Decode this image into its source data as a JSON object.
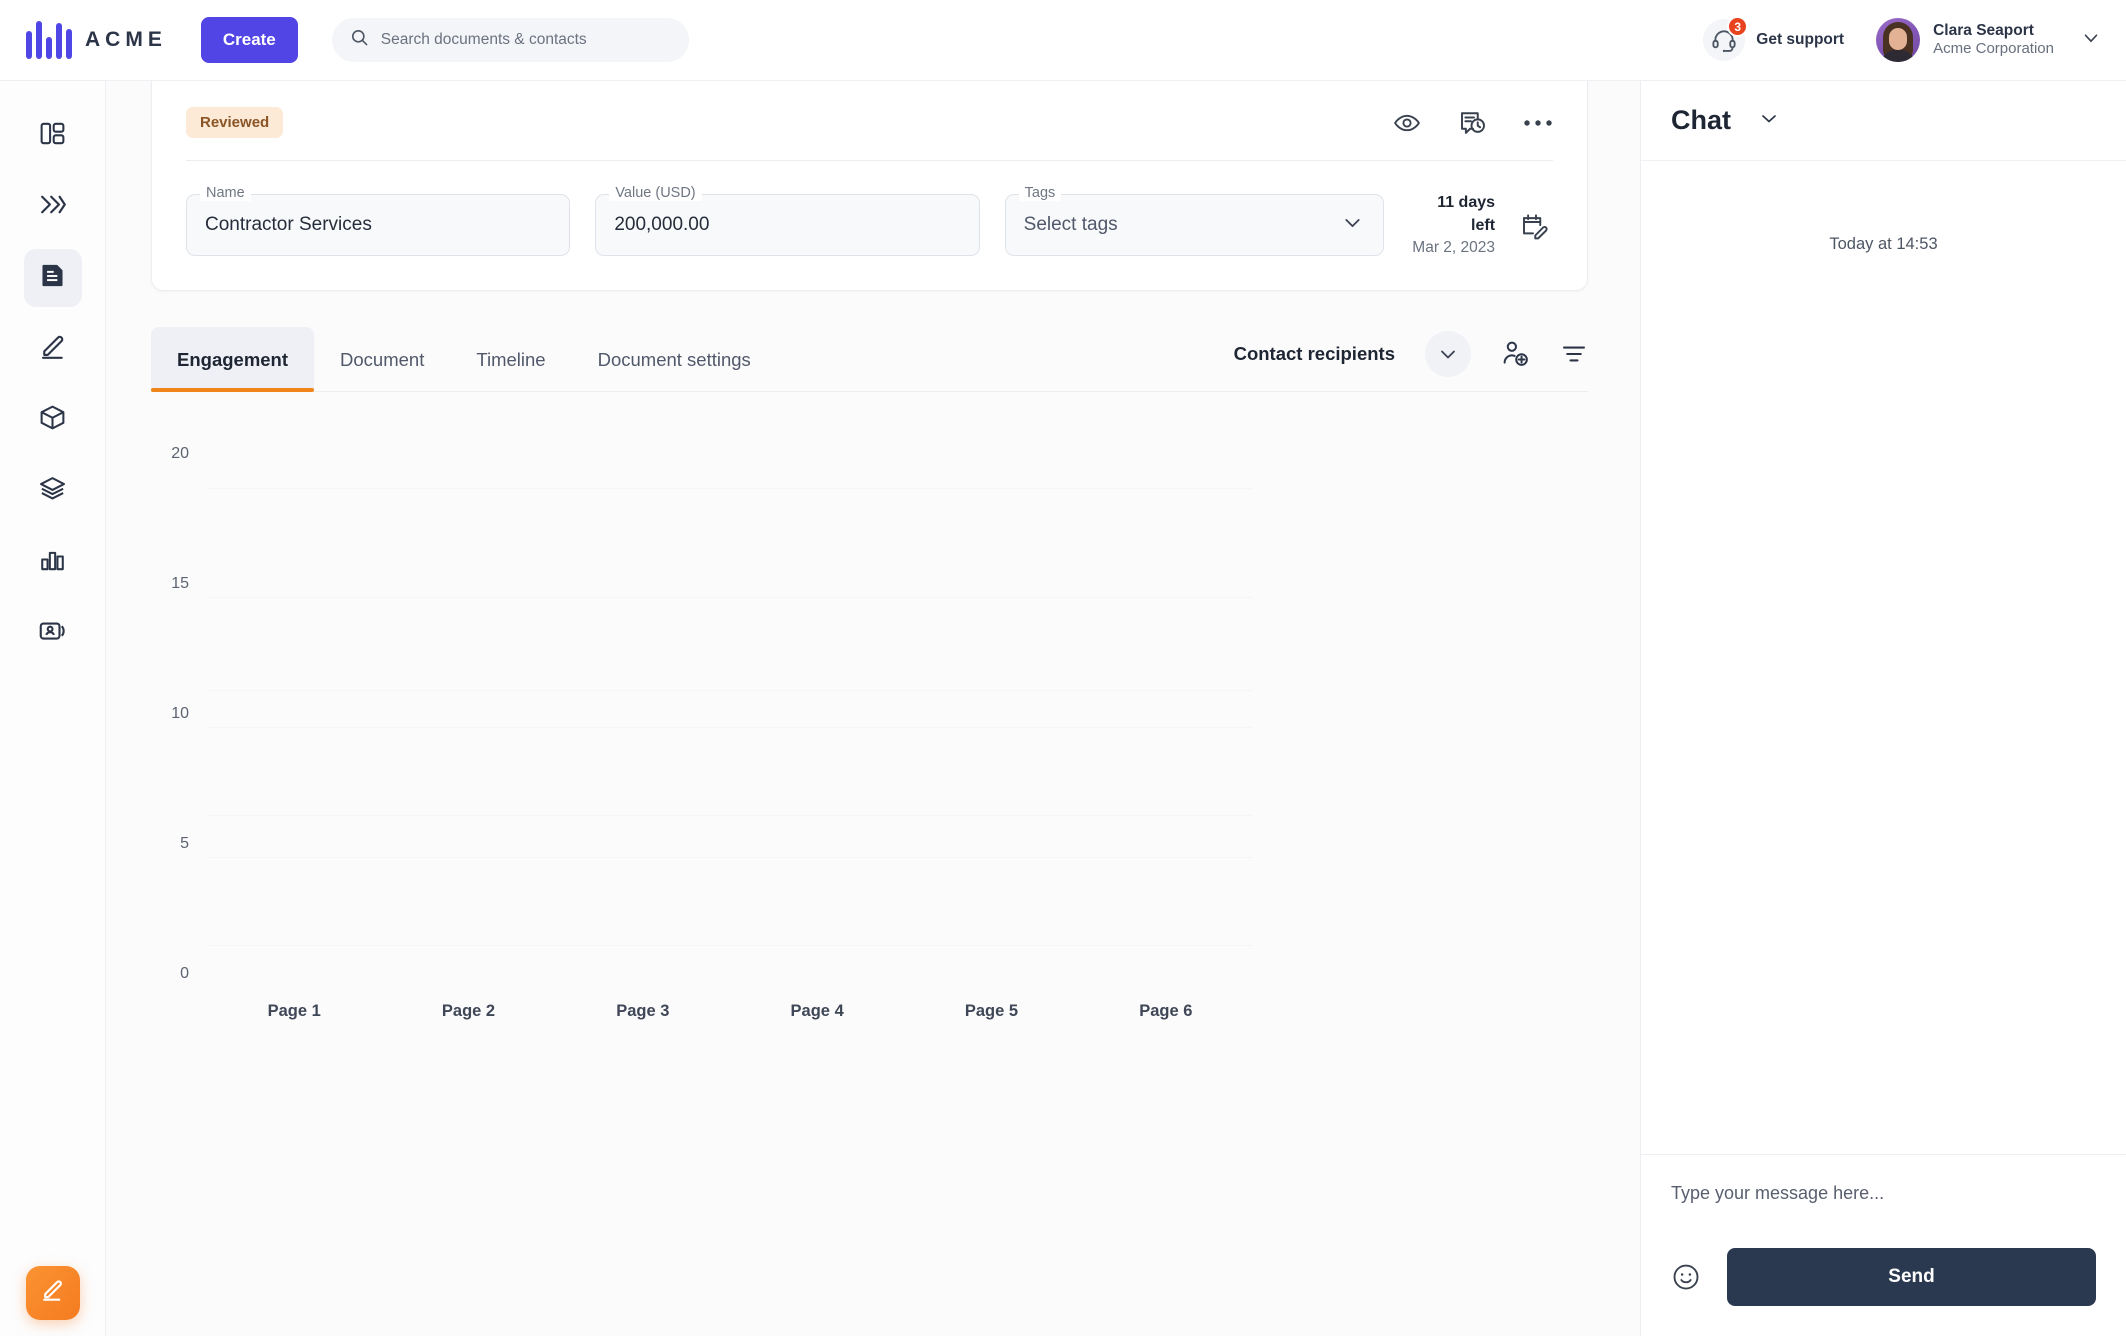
{
  "topbar": {
    "logo_text": "ACME",
    "logo_icon": "acme-bars-logo",
    "create_label": "Create",
    "search_placeholder": "Search documents & contacts",
    "search_icon": "search-icon",
    "support_label": "Get support",
    "support_icon": "headset-icon",
    "support_badge_count": "3",
    "user_name": "Clara Seaport",
    "user_org": "Acme Corporation",
    "user_caret_icon": "chevron-down-icon",
    "accent_color": "#5145e5",
    "badge_color": "#e8431f"
  },
  "sidebar": {
    "items": [
      {
        "icon": "dashboard-layout-icon",
        "active": false
      },
      {
        "icon": "double-chevron-right-icon",
        "active": false
      },
      {
        "icon": "document-icon",
        "active": true
      },
      {
        "icon": "sign-pencil-icon",
        "active": false
      },
      {
        "icon": "cube-icon",
        "active": false
      },
      {
        "icon": "layers-icon",
        "active": false
      },
      {
        "icon": "bar-chart-icon",
        "active": false
      },
      {
        "icon": "contact-card-icon",
        "active": false
      }
    ],
    "fab_icon": "edit-pencil-icon",
    "fab_color": "#f47b20"
  },
  "document": {
    "status_badge": "Reviewed",
    "status_badge_bg": "#fce9d6",
    "status_badge_fg": "#8a5526",
    "actions": [
      {
        "icon": "eye-icon"
      },
      {
        "icon": "document-history-icon"
      },
      {
        "icon": "more-horizontal-icon"
      }
    ],
    "fields": [
      {
        "label": "Name",
        "value": "Contractor Services",
        "placeholder": false
      },
      {
        "label": "Value (USD)",
        "value": "200,000.00",
        "placeholder": false
      },
      {
        "label": "Tags",
        "value": "Select tags",
        "placeholder": true,
        "caret_icon": "chevron-down-icon"
      }
    ],
    "due_days": "11 days left",
    "due_date": "Mar 2, 2023",
    "due_icon": "calendar-edit-icon"
  },
  "tabs": {
    "items": [
      {
        "label": "Engagement",
        "active": true
      },
      {
        "label": "Document",
        "active": false
      },
      {
        "label": "Timeline",
        "active": false
      },
      {
        "label": "Document settings",
        "active": false
      }
    ],
    "active_underline_color": "#f08519",
    "contact_recipients_label": "Contact recipients",
    "contact_recipients_caret_icon": "chevron-down-icon",
    "add_recipient_icon": "add-person-icon",
    "filter_icon": "filter-icon"
  },
  "chart_data": {
    "type": "bar",
    "title": "",
    "xlabel": "",
    "ylabel": "",
    "categories": [
      "Page 1",
      "Page 2",
      "Page 3",
      "Page 4",
      "Page 5",
      "Page 6"
    ],
    "values": [
      0,
      0,
      0,
      0,
      0,
      0
    ],
    "ytick_labels": [
      "20",
      "15",
      "10",
      "5",
      "0"
    ],
    "ytick_values": [
      20,
      15,
      10,
      5,
      0
    ],
    "ylim": [
      0,
      20
    ],
    "grid": true,
    "legend": "none",
    "note": "no data bars rendered"
  },
  "chat": {
    "title": "Chat",
    "collapse_icon": "chevron-down-icon",
    "timestamp": "Today at 14:53",
    "input_placeholder": "Type your message here...",
    "emoji_icon": "smiley-icon",
    "send_label": "Send",
    "send_color": "#2b3950"
  }
}
